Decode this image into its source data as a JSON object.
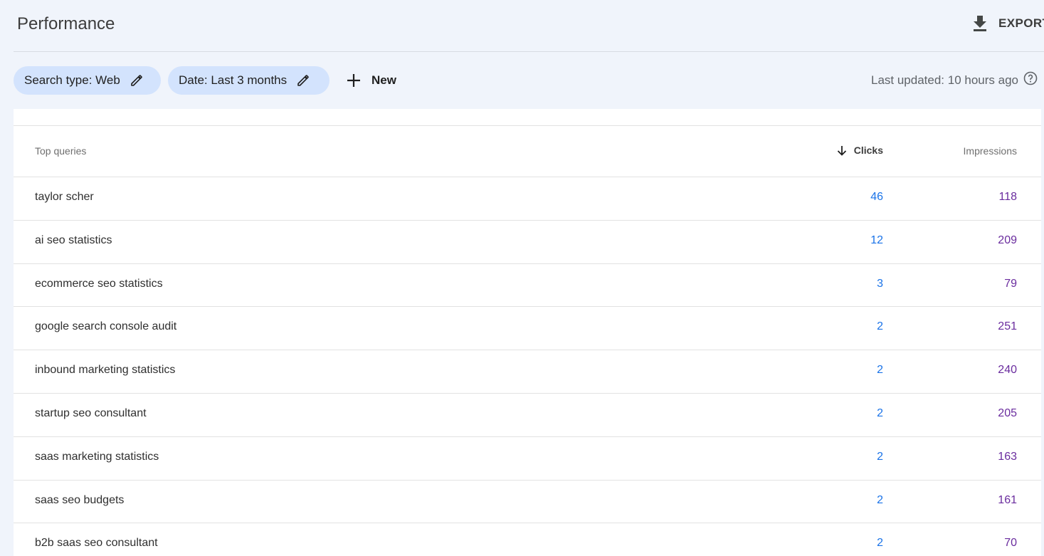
{
  "header": {
    "title": "Performance",
    "export_label": "EXPORT",
    "export_icon": "download-icon"
  },
  "filters": {
    "chips": [
      {
        "label": "Search type: Web",
        "icon": "edit-pencil-icon"
      },
      {
        "label": "Date: Last 3 months",
        "icon": "edit-pencil-icon"
      }
    ],
    "new_label": "New",
    "new_icon": "plus-icon",
    "last_updated": "Last updated: 10 hours ago",
    "help_icon": "help-circle-icon"
  },
  "table": {
    "columns": {
      "query": "Top queries",
      "clicks": "Clicks",
      "impressions": "Impressions"
    },
    "sort_icon": "arrow-down-icon",
    "rows": [
      {
        "query": "taylor scher",
        "clicks": "46",
        "impressions": "118"
      },
      {
        "query": "ai seo statistics",
        "clicks": "12",
        "impressions": "209"
      },
      {
        "query": "ecommerce seo statistics",
        "clicks": "3",
        "impressions": "79"
      },
      {
        "query": "google search console audit",
        "clicks": "2",
        "impressions": "251"
      },
      {
        "query": "inbound marketing statistics",
        "clicks": "2",
        "impressions": "240"
      },
      {
        "query": "startup seo consultant",
        "clicks": "2",
        "impressions": "205"
      },
      {
        "query": "saas marketing statistics",
        "clicks": "2",
        "impressions": "163"
      },
      {
        "query": "saas seo budgets",
        "clicks": "2",
        "impressions": "161"
      },
      {
        "query": "b2b saas seo consultant",
        "clicks": "2",
        "impressions": "70"
      }
    ]
  },
  "colors": {
    "background": "#f0f4fb",
    "chip": "#d3e3fd",
    "clicks": "#1a73e8",
    "impressions": "#6a2c9e"
  }
}
